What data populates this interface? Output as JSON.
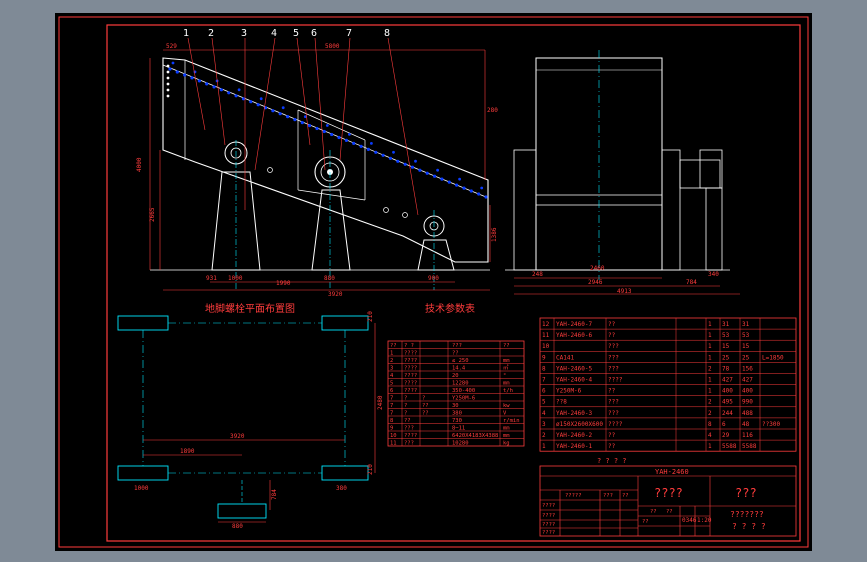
{
  "colors": {
    "viewport_bg": "#7f8a96",
    "paper": "#000000",
    "frame": "#ff3c3c",
    "drawing_outline": "#ffffff",
    "dimension": "#ff3c3c",
    "center": "#00e8ff",
    "bolts": "#0a3cff",
    "green": "#00ff40",
    "yellow": "#ffff00"
  },
  "callouts": [
    "1",
    "2",
    "3",
    "4",
    "5",
    "6",
    "7",
    "8"
  ],
  "front_view": {
    "dims": {
      "top_529": "529",
      "top_5800": "5800",
      "left_4000": "4000",
      "left_2665": "2665",
      "right_280": "280",
      "right_1386": "1386",
      "bottom_931": "931",
      "bottom_1000": "1000",
      "bottom_1990": "1990",
      "bottom_880": "880",
      "bottom_900": "900",
      "bottom_3920": "3920"
    }
  },
  "side_view": {
    "dims": {
      "d_248": "248",
      "d_2460": "2460",
      "d_2946": "2946",
      "d_784": "784",
      "d_340": "340",
      "d_4913": "4913"
    }
  },
  "plan_titles": {
    "anchor_plan": "地脚螺栓平面布置图",
    "tech_params": "技术参数表"
  },
  "anchor_plan": {
    "dims": {
      "left_span": "3920",
      "inner_span": "1890",
      "bl_1000": "1000",
      "br_380": "380",
      "bottom_880": "880",
      "r_210_top": "210",
      "r_2480": "2480",
      "r_210_bot": "210",
      "v_784": "784"
    }
  },
  "param_table": {
    "header": [
      "??",
      "? ?",
      "",
      "???",
      "??"
    ],
    "rows": [
      [
        "1",
        "????",
        "",
        "??",
        ""
      ],
      [
        "2",
        "????",
        "",
        "≤ 250",
        "mm"
      ],
      [
        "3",
        "????",
        "",
        "14.4",
        "㎡"
      ],
      [
        "4",
        "????",
        "",
        "20",
        "°"
      ],
      [
        "5",
        "????",
        "",
        "12280",
        "mm"
      ],
      [
        "6",
        "????",
        "",
        "350-400",
        "t/h"
      ],
      [
        "7",
        "?",
        "?",
        "Y250M-6",
        ""
      ],
      [
        "7",
        "?",
        "??",
        "30",
        "kw"
      ],
      [
        "7",
        "?",
        "??",
        "380",
        "V"
      ],
      [
        "8",
        "??",
        "",
        "730",
        "r/min"
      ],
      [
        "9",
        "???",
        "",
        "8~11",
        "mm"
      ],
      [
        "10",
        "????",
        "",
        "6420X4183X4388",
        "mm"
      ],
      [
        "11",
        "???",
        "",
        "10280",
        "kg"
      ]
    ]
  },
  "bom": {
    "rows": [
      [
        "12",
        "YAH-2460-7",
        "??",
        "",
        "1",
        "31",
        "31",
        ""
      ],
      [
        "11",
        "YAH-2460-6",
        "??",
        "",
        "1",
        "53",
        "53",
        ""
      ],
      [
        "10",
        "",
        "???",
        "",
        "1",
        "15",
        "15",
        ""
      ],
      [
        "9",
        "CA141",
        "???",
        "",
        "1",
        "25",
        "25",
        "L=1850"
      ],
      [
        "8",
        "YAH-2460-5",
        "???",
        "",
        "2",
        "78",
        "156",
        ""
      ],
      [
        "7",
        "YAH-2460-4",
        "????",
        "",
        "1",
        "427",
        "427",
        ""
      ],
      [
        "6",
        "Y250M-6",
        "??",
        "",
        "1",
        "400",
        "400",
        ""
      ],
      [
        "5",
        "??8",
        "???",
        "",
        "2",
        "495",
        "990",
        ""
      ],
      [
        "4",
        "YAH-2460-3",
        "???",
        "",
        "2",
        "244",
        "488",
        ""
      ],
      [
        "3",
        "ø150X2600X600",
        "????",
        "",
        "8",
        "6",
        "48",
        "??300"
      ],
      [
        "2",
        "YAH-2460-2",
        "??",
        "",
        "4",
        "29",
        "116",
        ""
      ],
      [
        "1",
        "YAH-2460-1",
        "??",
        "",
        "1",
        "5588",
        "5588",
        ""
      ]
    ],
    "header_text": "? ? ? ?",
    "model": "YAH-2460",
    "title_big": "????",
    "title_small": "???",
    "scale_cell": "1:20",
    "code_cell": "0346",
    "sig_rows": [
      "?????",
      "????",
      "????",
      "????",
      "????"
    ],
    "mini_headers": [
      "??",
      "??",
      "???",
      "??",
      "??"
    ],
    "right_bottom_1": "???????",
    "right_bottom_2": "? ? ? ?"
  }
}
